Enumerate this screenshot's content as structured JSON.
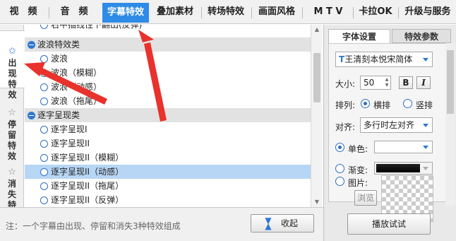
{
  "top_tabs": [
    {
      "label": "视　频",
      "active": false
    },
    {
      "label": "音　频",
      "active": false
    },
    {
      "label": "字幕特效",
      "active": true
    },
    {
      "label": "叠加素材",
      "active": false
    },
    {
      "label": "转场特效",
      "active": false
    },
    {
      "label": "画面风格",
      "active": false
    },
    {
      "label": "M T V",
      "active": false
    },
    {
      "label": "卡拉OK",
      "active": false
    },
    {
      "label": "升级与服务",
      "active": false
    }
  ],
  "side_tabs": [
    {
      "label": "出\n现\n特\n效",
      "icon": "star-icon",
      "active": true
    },
    {
      "label": "停\n留\n特\n效",
      "icon": "star-outline-icon",
      "active": false
    },
    {
      "label": "消\n失\n特\n效",
      "icon": "star-outline-icon",
      "active": false
    }
  ],
  "effects_list": [
    {
      "type": "item",
      "label": "右中插线性下翻出(反弹)",
      "selected": false
    },
    {
      "type": "group",
      "label": "波浪特效类"
    },
    {
      "type": "item",
      "label": "波浪",
      "selected": false
    },
    {
      "type": "item",
      "label": "波浪（模糊）",
      "selected": false
    },
    {
      "type": "item",
      "label": "波浪（动感）",
      "selected": false
    },
    {
      "type": "item",
      "label": "波浪（拖尾）",
      "selected": false
    },
    {
      "type": "group",
      "label": "逐字呈现类"
    },
    {
      "type": "item",
      "label": "逐字呈现I",
      "selected": false
    },
    {
      "type": "item",
      "label": "逐字呈现II",
      "selected": false
    },
    {
      "type": "item",
      "label": "逐字呈现II（模糊）",
      "selected": false
    },
    {
      "type": "item",
      "label": "逐字呈现II（动感）",
      "selected": true
    },
    {
      "type": "item",
      "label": "逐字呈现II（拖尾）",
      "selected": false
    },
    {
      "type": "item",
      "label": "逐字呈现II（反弹）",
      "selected": false
    }
  ],
  "bottom": {
    "note": "注：一个字幕由出现、停留和消失3种特效组成",
    "collapse_label": "收起"
  },
  "right_panel": {
    "tabs": [
      {
        "label": "字体设置",
        "active": true
      },
      {
        "label": "特效参数",
        "active": false
      }
    ],
    "font_value": "王清刻本悦宋简体",
    "size_label": "大小:",
    "size_value": "50",
    "bold_label": "B",
    "italic_label": "I",
    "arrange_label": "排列:",
    "horizontal_label": "横排",
    "vertical_label": "竖排",
    "align_label": "对齐:",
    "align_value": "多行时左对齐",
    "solid_color_label": "单色:",
    "gradient_label": "渐变:",
    "image_label": "图片:",
    "browse_label": "浏览",
    "play_test_label": "播放试试",
    "arrange_selected": "horizontal",
    "color_mode_selected": "solid"
  },
  "colors": {
    "accent": "#2e8be6",
    "selected_row": "#b7d6f5",
    "annotation": "#e8322b"
  }
}
